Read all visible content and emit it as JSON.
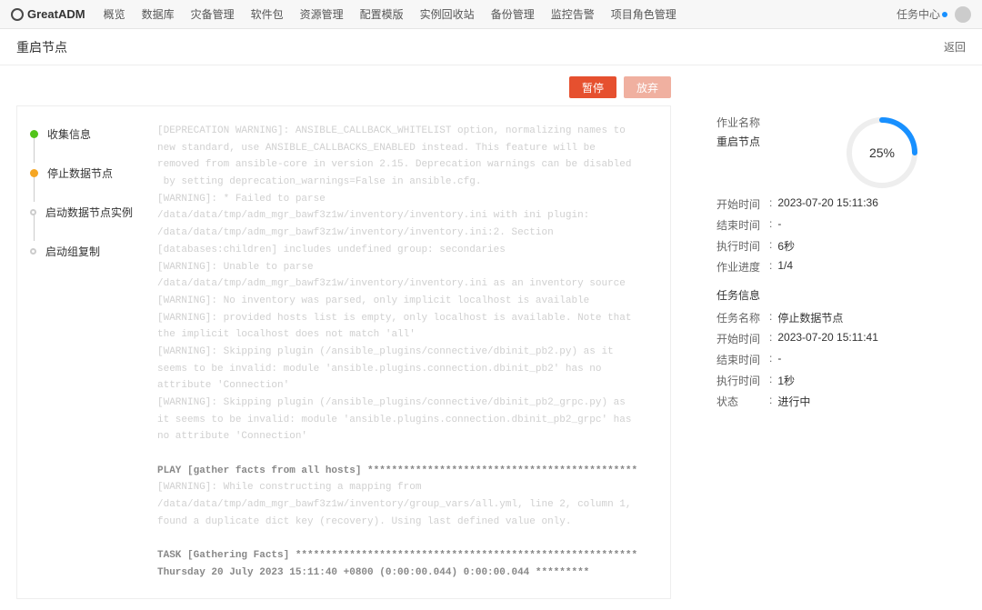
{
  "top_nav": {
    "logo": "GreatADM",
    "items": [
      "概览",
      "数据库",
      "灾备管理",
      "软件包",
      "资源管理",
      "配置模版",
      "实例回收站",
      "备份管理",
      "监控告警",
      "项目角色管理"
    ],
    "task_center": "任务中心"
  },
  "page": {
    "title": "重启节点",
    "back": "返回"
  },
  "actions": {
    "pause": "暂停",
    "abort": "放弃"
  },
  "steps": [
    {
      "label": "收集信息",
      "state": "done"
    },
    {
      "label": "停止数据节点",
      "state": "active"
    },
    {
      "label": "启动数据节点实例",
      "state": "pending"
    },
    {
      "label": "启动组复制",
      "state": "pending"
    }
  ],
  "log_lines": [
    {
      "t": "[DEPRECATION WARNING]: ANSIBLE_CALLBACK_WHITELIST option, normalizing names to",
      "s": false
    },
    {
      "t": "new standard, use ANSIBLE_CALLBACKS_ENABLED instead. This feature will be",
      "s": false
    },
    {
      "t": "removed from ansible-core in version 2.15. Deprecation warnings can be disabled",
      "s": false
    },
    {
      "t": " by setting deprecation_warnings=False in ansible.cfg.",
      "s": false
    },
    {
      "t": "[WARNING]: * Failed to parse",
      "s": false
    },
    {
      "t": "/data/data/tmp/adm_mgr_bawf3z1w/inventory/inventory.ini with ini plugin:",
      "s": false
    },
    {
      "t": "/data/data/tmp/adm_mgr_bawf3z1w/inventory/inventory.ini:2. Section",
      "s": false
    },
    {
      "t": "[databases:children] includes undefined group: secondaries",
      "s": false
    },
    {
      "t": "[WARNING]: Unable to parse",
      "s": false
    },
    {
      "t": "/data/data/tmp/adm_mgr_bawf3z1w/inventory/inventory.ini as an inventory source",
      "s": false
    },
    {
      "t": "[WARNING]: No inventory was parsed, only implicit localhost is available",
      "s": false
    },
    {
      "t": "[WARNING]: provided hosts list is empty, only localhost is available. Note that",
      "s": false
    },
    {
      "t": "the implicit localhost does not match 'all'",
      "s": false
    },
    {
      "t": "[WARNING]: Skipping plugin (/ansible_plugins/connective/dbinit_pb2.py) as it",
      "s": false
    },
    {
      "t": "seems to be invalid: module 'ansible.plugins.connection.dbinit_pb2' has no",
      "s": false
    },
    {
      "t": "attribute 'Connection'",
      "s": false
    },
    {
      "t": "[WARNING]: Skipping plugin (/ansible_plugins/connective/dbinit_pb2_grpc.py) as",
      "s": false
    },
    {
      "t": "it seems to be invalid: module 'ansible.plugins.connection.dbinit_pb2_grpc' has",
      "s": false
    },
    {
      "t": "no attribute 'Connection'",
      "s": false
    },
    {
      "t": "",
      "s": false
    },
    {
      "t": "PLAY [gather facts from all hosts] *********************************************",
      "s": true
    },
    {
      "t": "[WARNING]: While constructing a mapping from",
      "s": false
    },
    {
      "t": "/data/data/tmp/adm_mgr_bawf3z1w/inventory/group_vars/all.yml, line 2, column 1,",
      "s": false
    },
    {
      "t": "found a duplicate dict key (recovery). Using last defined value only.",
      "s": false
    },
    {
      "t": "",
      "s": false
    },
    {
      "t": "TASK [Gathering Facts] *********************************************************",
      "s": true
    },
    {
      "t": "Thursday 20 July 2023 15:11:40 +0800 (0:00:00.044) 0:00:00.044 *********",
      "s": true
    }
  ],
  "right": {
    "job_label": "作业名称",
    "job_name": "重启节点",
    "progress_text": "25%",
    "summary": [
      {
        "k": "开始时间",
        "v": "2023-07-20 15:11:36"
      },
      {
        "k": "结束时间",
        "v": "-"
      },
      {
        "k": "执行时间",
        "v": "6秒"
      },
      {
        "k": "作业进度",
        "v": "1/4"
      }
    ],
    "task_section": "任务信息",
    "task_info": [
      {
        "k": "任务名称",
        "v": "停止数据节点"
      },
      {
        "k": "开始时间",
        "v": "2023-07-20 15:11:41"
      },
      {
        "k": "结束时间",
        "v": "-"
      },
      {
        "k": "执行时间",
        "v": "1秒"
      },
      {
        "k": "状态",
        "v": "进行中"
      }
    ]
  }
}
